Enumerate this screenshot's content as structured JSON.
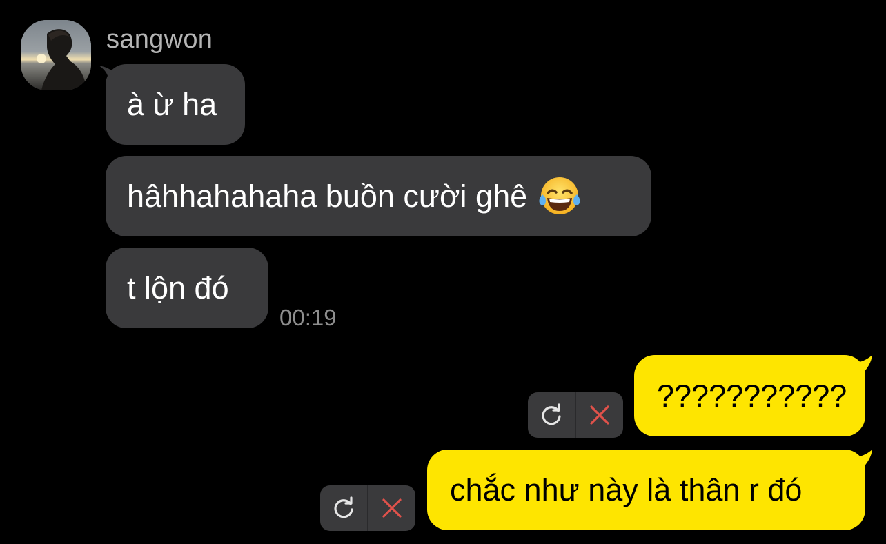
{
  "sender": {
    "name": "sangwon"
  },
  "incoming_messages": [
    {
      "text": "à ừ ha"
    },
    {
      "text": "hâhhahahaha buồn cười ghê",
      "emoji": "face-with-tears-of-joy"
    },
    {
      "text": "t lộn đó"
    }
  ],
  "incoming_time": "00:19",
  "outgoing_messages": [
    {
      "text": "???????????",
      "status": "failed"
    },
    {
      "text": "chắc như này là thân r đó",
      "status": "failed"
    }
  ],
  "icons": {
    "retry": "refresh-icon",
    "delete": "close-icon"
  },
  "colors": {
    "background": "#000000",
    "incoming_bubble": "#3a3a3c",
    "outgoing_bubble": "#fee500",
    "delete_x": "#e0524b",
    "sender_name": "#b4b4b4",
    "timestamp": "#8e8e8e"
  }
}
